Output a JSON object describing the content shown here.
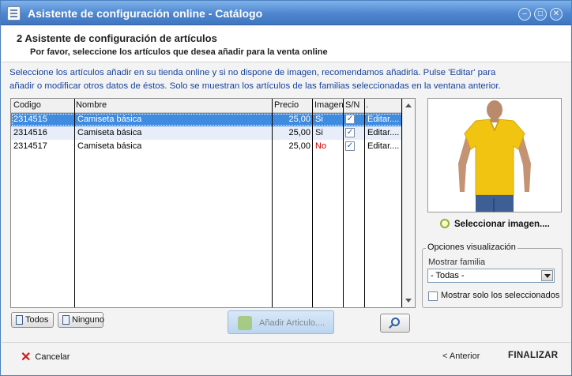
{
  "window": {
    "title": "Asistente de configuración online - Catálogo",
    "minimize": "–",
    "maximize": "□",
    "close": "✕"
  },
  "header": {
    "step_title": "2 Asistente de configuración de artículos",
    "step_subtitle": "Por favor, seleccione los artículos que desea añadir para la venta online"
  },
  "instructions": {
    "line1": "Seleccione los artículos añadir en su tienda online y si no dispone de imagen, recomendamos añadirla. Pulse 'Editar' para",
    "line2": "añadir o modificar otros datos de éstos. Solo se muestran los artículos de las familias seleccionadas en la ventana anterior."
  },
  "grid": {
    "columns": {
      "codigo": "Codigo",
      "nombre": "Nombre",
      "precio": "Precio",
      "imagen": "Imagen",
      "sn": "S/N",
      "extra": "."
    },
    "rows": [
      {
        "codigo": "2314515",
        "nombre": "Camiseta básica",
        "precio": "25,00",
        "imagen": "Si",
        "sn": "✓",
        "editar": "Editar...."
      },
      {
        "codigo": "2314516",
        "nombre": "Camiseta básica",
        "precio": "25,00",
        "imagen": "Si",
        "sn": "✓",
        "editar": "Editar...."
      },
      {
        "codigo": "2314517",
        "nombre": "Camiseta básica",
        "precio": "25,00",
        "imagen": "No",
        "sn": "✓",
        "editar": "Editar...."
      }
    ]
  },
  "buttons": {
    "todos": "Todos",
    "ninguno": "Ninguno",
    "add_article": "Añadir Articulo....",
    "select_image": "Seleccionar imagen....",
    "cancel": "Cancelar",
    "previous": "< Anterior",
    "finish": "FINALIZAR"
  },
  "options": {
    "legend": "Opciones visualización",
    "family_label": "Mostrar familia",
    "family_value": "- Todas -",
    "only_selected_label": "Mostrar solo los seleccionados"
  },
  "colors": {
    "title_bar": "#4d86cf",
    "selection": "#3f8be0",
    "instructions_text": "#17429b",
    "no_image_text": "#c80000",
    "shirt": "#f2c412"
  },
  "icons": {
    "app": "document-icon",
    "cancel": "red-x-icon",
    "select_image": "magnifier-icon",
    "add_article": "puzzle-piece-icon",
    "search": "magnifier-icon"
  }
}
